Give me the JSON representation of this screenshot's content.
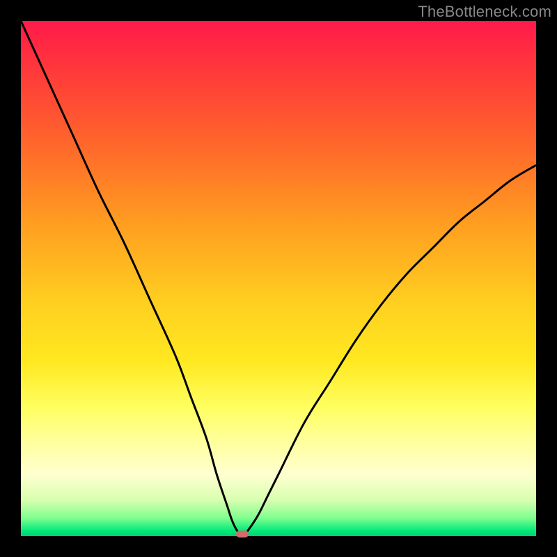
{
  "watermark": "TheBottleneck.com",
  "colors": {
    "frame": "#000000",
    "gradient_top": "#ff1a4a",
    "gradient_bottom": "#00d070",
    "curve": "#000000",
    "marker": "#d46a6a"
  },
  "chart_data": {
    "type": "line",
    "title": "",
    "xlabel": "",
    "ylabel": "",
    "xlim": [
      0,
      100
    ],
    "ylim": [
      0,
      100
    ],
    "grid": false,
    "legend": null,
    "series": [
      {
        "name": "bottleneck-curve",
        "x": [
          0,
          5,
          10,
          15,
          20,
          25,
          30,
          33,
          36,
          38,
          40,
          41,
          42,
          43,
          44,
          46,
          48,
          50,
          55,
          60,
          65,
          70,
          75,
          80,
          85,
          90,
          95,
          100
        ],
        "y": [
          100,
          89,
          78,
          67,
          57,
          46,
          35,
          27,
          19,
          12,
          6,
          3,
          1,
          0,
          1,
          4,
          8,
          12,
          22,
          30,
          38,
          45,
          51,
          56,
          61,
          65,
          69,
          72
        ]
      }
    ],
    "annotations": [
      {
        "name": "min-marker",
        "x": 43,
        "y": 0
      }
    ],
    "gradient_stops": [
      {
        "pos": 0,
        "color": "#ff1a4a"
      },
      {
        "pos": 0.55,
        "color": "#ffd020"
      },
      {
        "pos": 0.82,
        "color": "#ffffa0"
      },
      {
        "pos": 1.0,
        "color": "#00d070"
      }
    ]
  }
}
